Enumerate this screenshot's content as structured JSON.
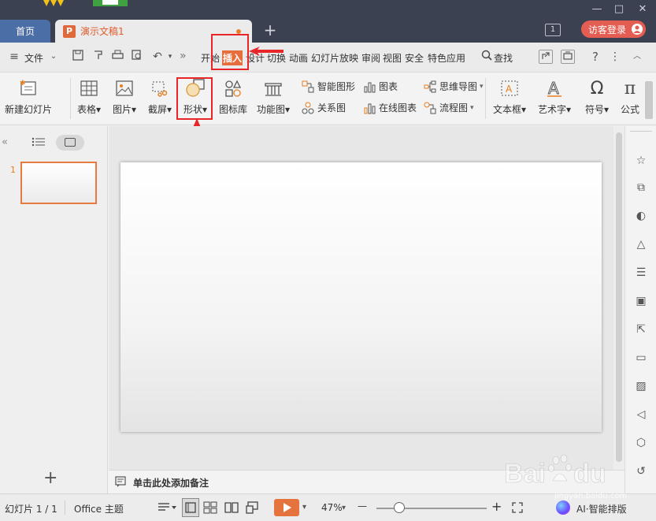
{
  "titlebar": {
    "home_tab": "首页",
    "doc_tab": "演示文稿1",
    "doc_tab_icon": "P",
    "plus": "+",
    "window_badge": "1",
    "login": "访客登录",
    "minimize": "—",
    "maximize": "□",
    "close": "✕"
  },
  "menubar": {
    "file": "文件",
    "more": "»",
    "tabs": [
      "开始",
      "插入",
      "设计",
      "切换",
      "动画",
      "幻灯片放映",
      "审阅",
      "视图",
      "安全",
      "特色应用"
    ],
    "search": "查找"
  },
  "ribbon": {
    "new_slide": "新建幻灯片",
    "table": "表格",
    "picture": "图片",
    "screenshot": "截屏",
    "shape": "形状",
    "icon_library": "图标库",
    "function_chart": "功能图",
    "smart_graphic": "智能图形",
    "chart": "图表",
    "relation_chart": "关系图",
    "online_chart": "在线图表",
    "mind_map": "思维导图",
    "flow_chart": "流程图",
    "text_box": "文本框",
    "art_text": "艺术字",
    "symbol": "符号",
    "formula": "公式",
    "symbol_glyph": "Ω",
    "formula_glyph": "π"
  },
  "left_panel": {
    "slide_number": "1",
    "collapse": "«",
    "add": "+"
  },
  "notes": {
    "placeholder": "单击此处添加备注"
  },
  "statusbar": {
    "slide_info": "幻灯片 1 / 1",
    "theme": "Office 主题",
    "zoom": "47%",
    "minus": "—",
    "plus": "+",
    "ai": "AI·智能排版"
  },
  "watermark": {
    "site": "jingyan.baidu.com"
  },
  "colors": {
    "titlebar_bg": "#3b4151",
    "accent_orange": "#e76e3c",
    "highlight_red": "#e8262a",
    "home_tab_bg": "#4c6ea6",
    "login_bg": "#e35d52"
  }
}
